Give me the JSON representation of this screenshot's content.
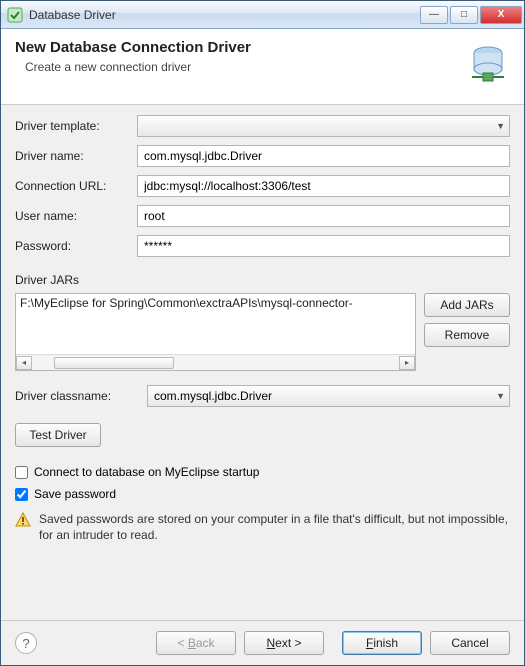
{
  "window": {
    "title": "Database Driver"
  },
  "banner": {
    "title": "New Database Connection Driver",
    "subtitle": "Create a new connection driver"
  },
  "form": {
    "template_label": "Driver template:",
    "template_value": "",
    "name_label": "Driver name:",
    "name_value": "com.mysql.jdbc.Driver",
    "url_label": "Connection URL:",
    "url_value": "jdbc:mysql://localhost:3306/test",
    "user_label": "User name:",
    "user_value": "root",
    "pass_label": "Password:",
    "pass_value": "******"
  },
  "jars": {
    "section_label": "Driver JARs",
    "items": [
      "F:\\MyEclipse for Spring\\Common\\exctraAPIs\\mysql-connector-"
    ],
    "add_label": "Add JARs",
    "remove_label": "Remove"
  },
  "classname": {
    "label": "Driver classname:",
    "value": "com.mysql.jdbc.Driver"
  },
  "test_label": "Test Driver",
  "opts": {
    "connect_startup_label": "Connect to database on MyEclipse startup",
    "connect_startup_checked": false,
    "save_pass_label": "Save password",
    "save_pass_checked": true,
    "warning": "Saved passwords are stored on your computer in a file that's difficult, but not impossible, for an intruder to read."
  },
  "buttons": {
    "back": "< Back",
    "next": "Next >",
    "finish": "Finish",
    "cancel": "Cancel"
  }
}
